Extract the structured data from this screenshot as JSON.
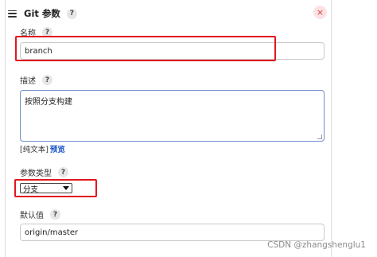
{
  "header": {
    "title": "Git 参数",
    "help": "?",
    "close": "×"
  },
  "fields": {
    "name": {
      "label": "名称",
      "help": "?",
      "value": "branch"
    },
    "description": {
      "label": "描述",
      "help": "?",
      "value": "按照分支构建"
    },
    "format": {
      "plain_text": "[纯文本]",
      "preview": "预览"
    },
    "param_type": {
      "label": "参数类型",
      "help": "?",
      "selected": "分支"
    },
    "default_value": {
      "label": "默认值",
      "help": "?",
      "value": "origin/master"
    }
  },
  "watermark": "CSDN @zhangshenglu1",
  "colors": {
    "highlight": "#e0181e",
    "link": "#1a56c7",
    "close": "#d33a3a"
  },
  "icons": {
    "menu": "hamburger-icon",
    "close": "close-icon",
    "help": "help-icon",
    "dropdown": "chevron-down-icon"
  }
}
